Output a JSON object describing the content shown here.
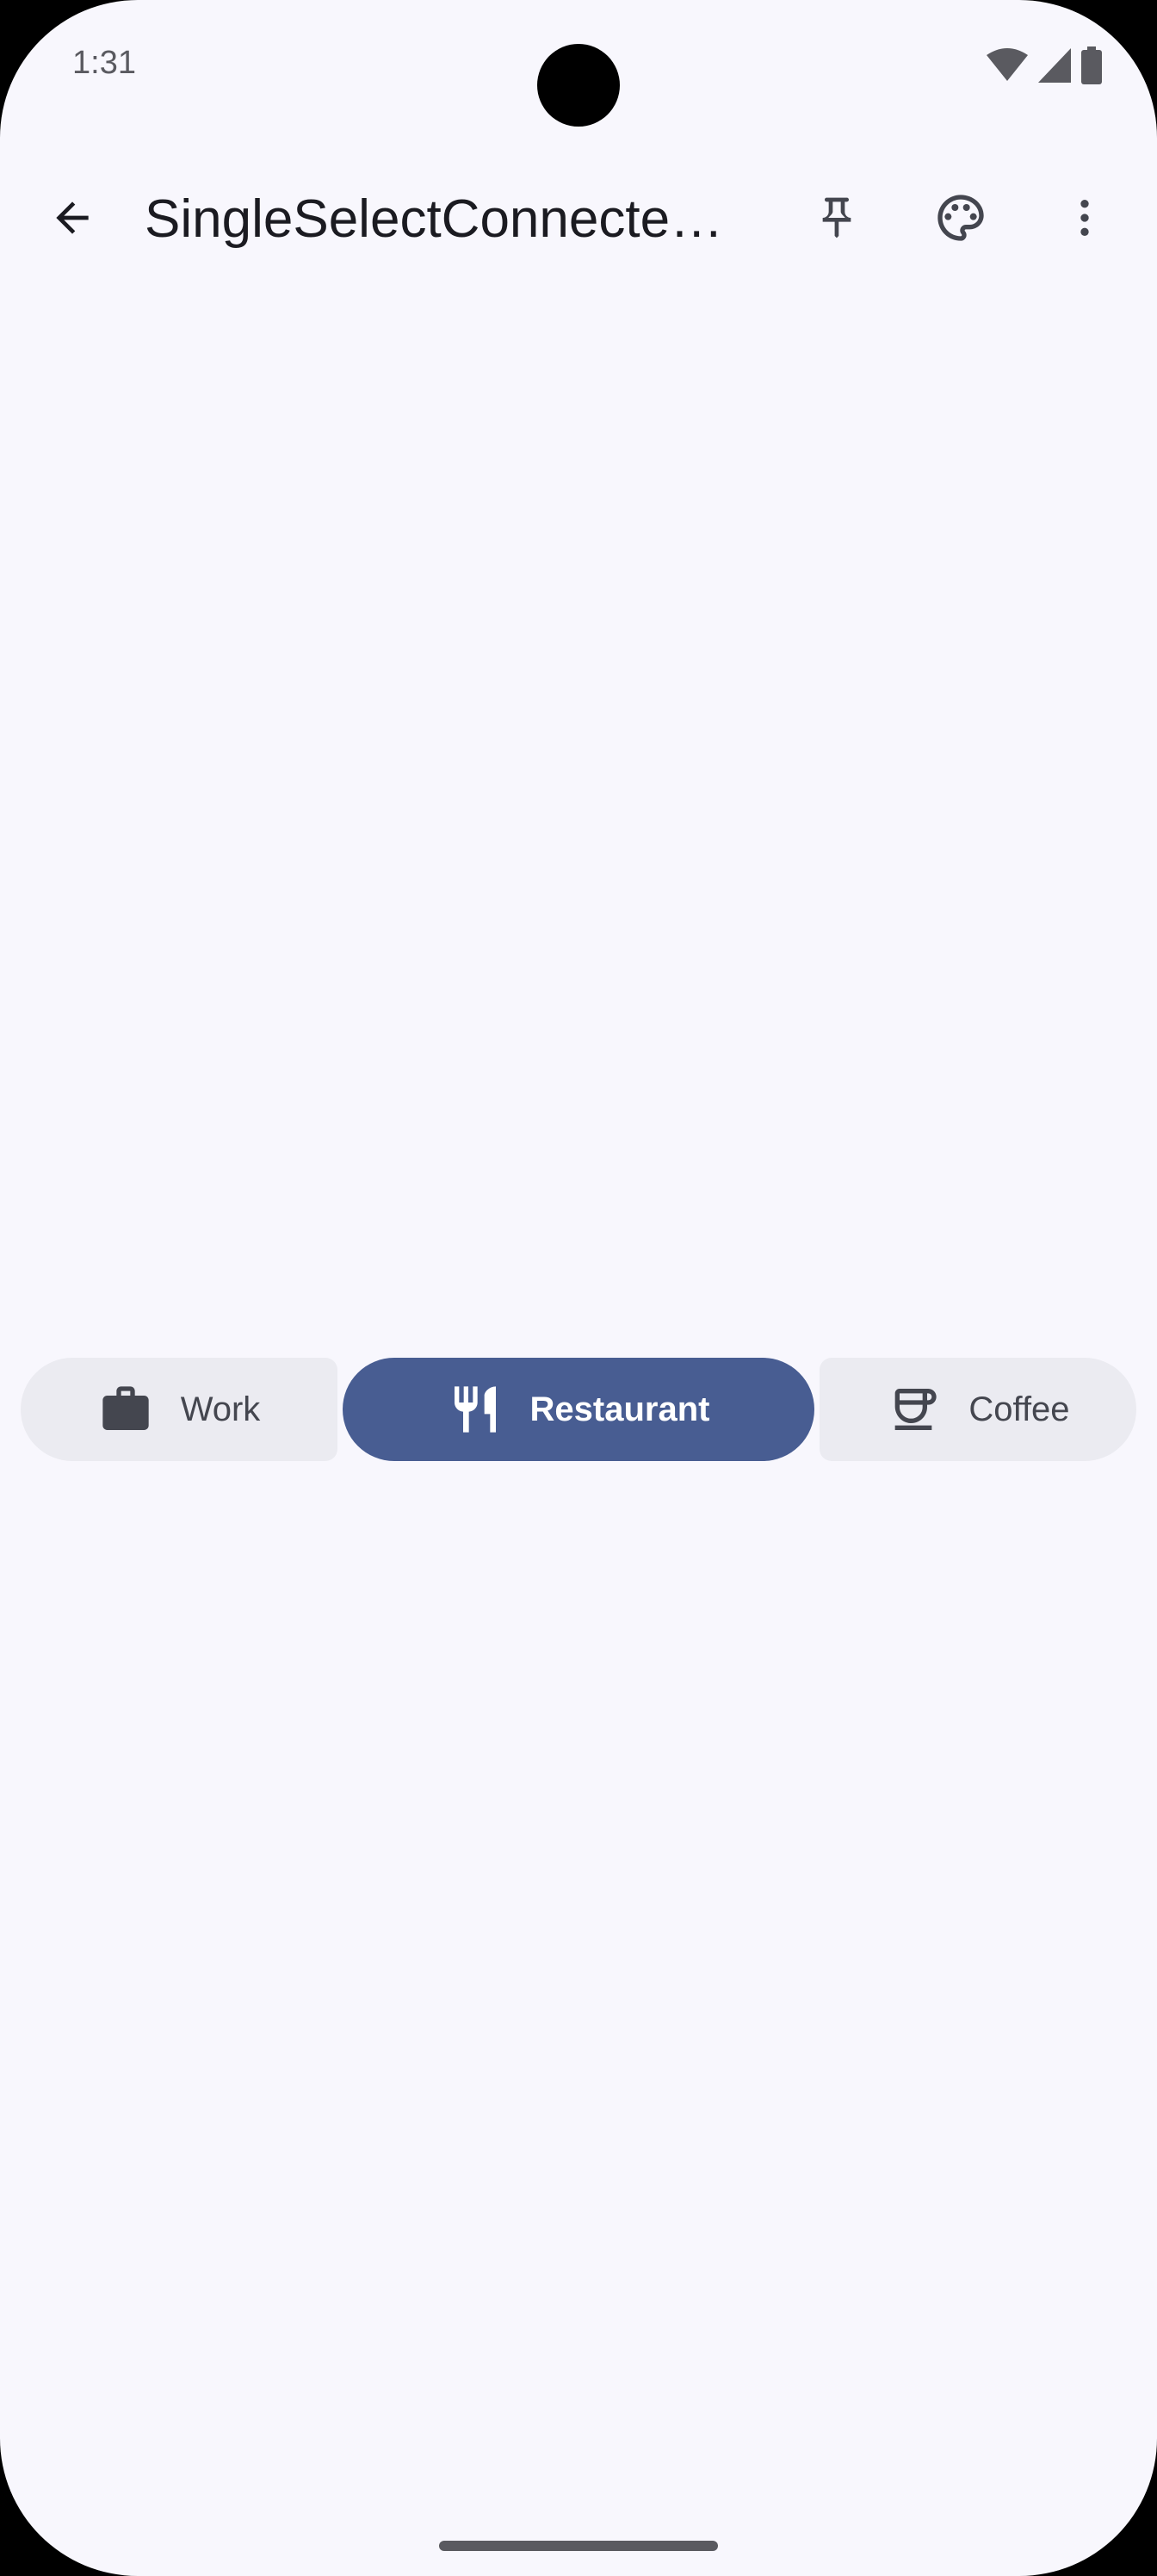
{
  "status_bar": {
    "time": "1:31",
    "icons": [
      "wifi-icon",
      "signal-icon",
      "battery-icon"
    ]
  },
  "app_bar": {
    "title": "SingleSelectConnecte…",
    "actions": [
      "back-arrow-icon",
      "pin-icon",
      "palette-icon",
      "more-vert-icon"
    ]
  },
  "button_group": {
    "selected": "Restaurant",
    "items": [
      {
        "label": "Work",
        "icon": "work-icon",
        "selected": false
      },
      {
        "label": "Restaurant",
        "icon": "restaurant-icon",
        "selected": true
      },
      {
        "label": "Coffee",
        "icon": "coffee-icon",
        "selected": false
      }
    ]
  },
  "colors": {
    "background": "#f8f7fd",
    "selected_container": "#485d92",
    "unselected_container": "#ebebf1",
    "on_surface": "#1b1b21",
    "on_surface_variant": "#44464f"
  }
}
